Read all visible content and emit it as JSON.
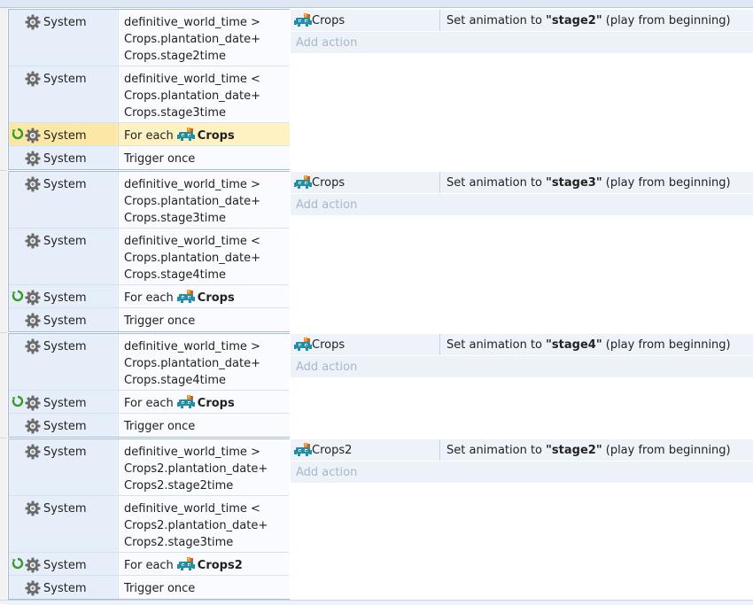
{
  "events": [
    {
      "conditions": [
        {
          "object": "System",
          "lines": [
            "definitive_world_time >",
            "Crops.plantation_date+",
            "Crops.stage2time"
          ]
        },
        {
          "object": "System",
          "lines": [
            "definitive_world_time <",
            "Crops.plantation_date+",
            "Crops.stage3time"
          ]
        },
        {
          "object": "System",
          "for_each_label": "For each",
          "for_each_object": "Crops"
        },
        {
          "object": "System",
          "lines": [
            "Trigger once"
          ]
        }
      ],
      "action": {
        "object": "Crops",
        "prefix": "Set animation to ",
        "value": "\"stage2\"",
        "suffix": " (play from beginning)"
      },
      "add_action": "Add action"
    },
    {
      "conditions": [
        {
          "object": "System",
          "lines": [
            "definitive_world_time >",
            "Crops.plantation_date+",
            "Crops.stage3time"
          ]
        },
        {
          "object": "System",
          "lines": [
            "definitive_world_time <",
            "Crops.plantation_date+",
            "Crops.stage4time"
          ]
        },
        {
          "object": "System",
          "for_each_label": "For each",
          "for_each_object": "Crops"
        },
        {
          "object": "System",
          "lines": [
            "Trigger once"
          ]
        }
      ],
      "action": {
        "object": "Crops",
        "prefix": "Set animation to ",
        "value": "\"stage3\"",
        "suffix": " (play from beginning)"
      },
      "add_action": "Add action"
    },
    {
      "conditions": [
        {
          "object": "System",
          "lines": [
            "definitive_world_time >",
            "Crops.plantation_date+",
            "Crops.stage4time"
          ]
        },
        {
          "object": "System",
          "for_each_label": "For each",
          "for_each_object": "Crops"
        },
        {
          "object": "System",
          "lines": [
            "Trigger once"
          ]
        }
      ],
      "action": {
        "object": "Crops",
        "prefix": "Set animation to ",
        "value": "\"stage4\"",
        "suffix": " (play from beginning)"
      },
      "add_action": "Add action"
    },
    {
      "conditions": [
        {
          "object": "System",
          "lines": [
            "definitive_world_time >",
            "Crops2.plantation_date+",
            "Crops2.stage2time"
          ]
        },
        {
          "object": "System",
          "lines": [
            "definitive_world_time <",
            "Crops2.plantation_date+",
            "Crops2.stage3time"
          ]
        },
        {
          "object": "System",
          "for_each_label": "For each",
          "for_each_object": "Crops2"
        },
        {
          "object": "System",
          "lines": [
            "Trigger once"
          ]
        }
      ],
      "action": {
        "object": "Crops2",
        "prefix": "Set animation to ",
        "value": "\"stage2\"",
        "suffix": " (play from beginning)"
      },
      "add_action": "Add action"
    }
  ],
  "icons": {
    "system": "gear-icon",
    "object": "crop-sprite-icon",
    "loop": "loop-icon"
  },
  "colors": {
    "condition_bg": "#eef3fa",
    "selected_bg": "#fff2c2",
    "add_action_text": "#a8b7c9",
    "loop_green": "#3a9a2a",
    "sprite_teal": "#1e8fa8"
  }
}
